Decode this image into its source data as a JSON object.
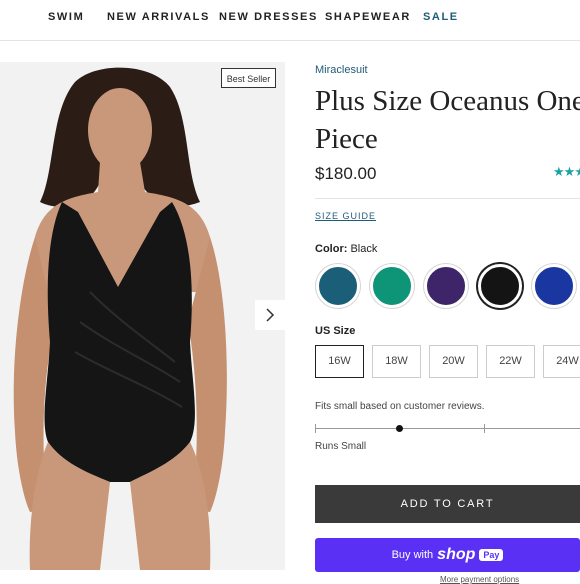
{
  "nav": {
    "items": [
      "SWIM",
      "NEW ARRIVALS",
      "NEW DRESSES",
      "SHAPEWEAR",
      "SALE"
    ]
  },
  "gallery": {
    "badge": "Best Seller",
    "next_icon": "chevron-right-icon"
  },
  "product": {
    "brand": "Miraclesuit",
    "title": "Plus Size Oceanus One Piece",
    "price": "$180.00",
    "rating_stars": 3,
    "size_guide": "SIZE GUIDE",
    "color_label": "Color:",
    "color_value": "Black",
    "swatches": [
      {
        "name": "Teal",
        "hex": "#1b5e77"
      },
      {
        "name": "Green",
        "hex": "#0e9577"
      },
      {
        "name": "Purple",
        "hex": "#3e2468"
      },
      {
        "name": "Black",
        "hex": "#141414",
        "selected": true
      },
      {
        "name": "Blue",
        "hex": "#1a36a0"
      }
    ],
    "size_label": "US Size",
    "sizes": [
      "16W",
      "18W",
      "20W",
      "22W",
      "24W"
    ],
    "selected_size": "16W",
    "fit_note": "Fits small based on customer reviews.",
    "fit_level": 0.32,
    "fit_result": "Runs Small"
  },
  "actions": {
    "add_to_cart": "ADD TO CART",
    "shoppay_prefix": "Buy with",
    "shoppay_brand": "shop",
    "shoppay_badge": "Pay",
    "more_options": "More payment options"
  },
  "colors": {
    "accent": "#1f5b7a",
    "stars": "#1aa3a3",
    "cart_button": "#3a3a3a",
    "shoppay": "#5a31f4"
  }
}
